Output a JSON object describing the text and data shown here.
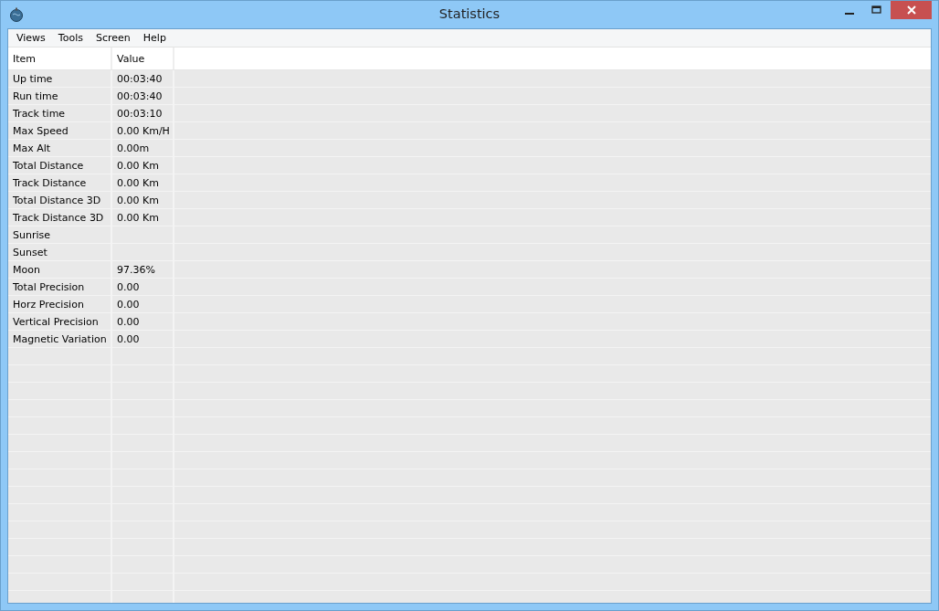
{
  "window": {
    "title": "Statistics"
  },
  "menu": [
    "Views",
    "Tools",
    "Screen",
    "Help"
  ],
  "table": {
    "columns": [
      "Item",
      "Value"
    ],
    "rows": [
      {
        "item": "Up time",
        "value": "00:03:40"
      },
      {
        "item": "Run time",
        "value": "00:03:40"
      },
      {
        "item": "Track time",
        "value": "00:03:10"
      },
      {
        "item": "Max Speed",
        "value": "0.00 Km/H"
      },
      {
        "item": "Max Alt",
        "value": "0.00m"
      },
      {
        "item": "Total Distance",
        "value": "0.00 Km"
      },
      {
        "item": "Track Distance",
        "value": "0.00 Km"
      },
      {
        "item": "Total Distance 3D",
        "value": "0.00 Km"
      },
      {
        "item": "Track Distance 3D",
        "value": "0.00 Km"
      },
      {
        "item": "Sunrise",
        "value": ""
      },
      {
        "item": "Sunset",
        "value": ""
      },
      {
        "item": "Moon",
        "value": "97.36%"
      },
      {
        "item": "Total Precision",
        "value": "0.00"
      },
      {
        "item": "Horz Precision",
        "value": "0.00"
      },
      {
        "item": "Vertical Precision",
        "value": "0.00"
      },
      {
        "item": "Magnetic Variation",
        "value": "0.00"
      }
    ]
  }
}
